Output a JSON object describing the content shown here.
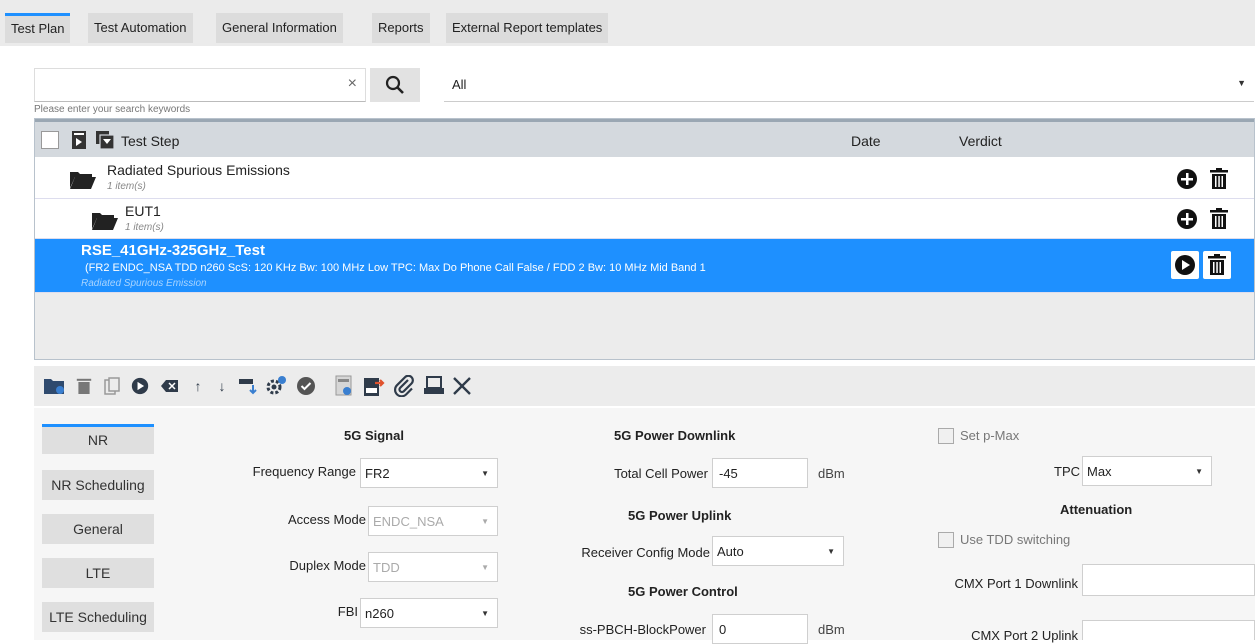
{
  "tabs": [
    "Test Plan",
    "Test Automation",
    "General Information",
    "Reports",
    "External Report templates"
  ],
  "search": {
    "value": "",
    "clear_symbol": "×",
    "hint": "Please enter your search keywords"
  },
  "filter": {
    "value": "All"
  },
  "table": {
    "headers": {
      "test_step": "Test Step",
      "date": "Date",
      "verdict": "Verdict"
    },
    "rows": [
      {
        "title": "Radiated Spurious Emissions",
        "sub": "1 item(s)"
      },
      {
        "title": "EUT1",
        "sub": "1 item(s)"
      },
      {
        "title": "RSE_41GHz-325GHz_Test",
        "detail": "(FR2 ENDC_NSA TDD n260 ScS: 120 KHz Bw: 100 MHz Low TPC: Max Do Phone Call False / FDD 2 Bw: 10 MHz Mid Band 1",
        "sub": "Radiated Spurious Emission"
      }
    ]
  },
  "sidebar": [
    "NR",
    "NR Scheduling",
    "General",
    "LTE",
    "LTE Scheduling"
  ],
  "signal": {
    "title": "5G Signal",
    "freq_label": "Frequency Range",
    "freq_value": "FR2",
    "access_label": "Access Mode",
    "access_value": "ENDC_NSA",
    "duplex_label": "Duplex Mode",
    "duplex_value": "TDD",
    "fbi_label": "FBI",
    "fbi_value": "n260"
  },
  "power_downlink": {
    "title": "5G Power Downlink",
    "label": "Total Cell Power",
    "value": "-45",
    "unit": "dBm"
  },
  "power_uplink": {
    "title": "5G Power Uplink",
    "label": "Receiver Config Mode",
    "value": "Auto"
  },
  "power_control": {
    "title": "5G Power Control",
    "label": "ss-PBCH-BlockPower",
    "value": "0",
    "unit": "dBm"
  },
  "right": {
    "pmax_label": "Set p-Max",
    "tpc_label": "TPC",
    "tpc_value": "Max",
    "atten_title": "Attenuation",
    "tdd_label": "Use TDD switching",
    "port1_label": "CMX Port 1 Downlink",
    "port2_label": "CMX Port 2 Uplink"
  },
  "colors": {
    "accent": "#1e90ff",
    "selected_row": "#1e90ff"
  }
}
